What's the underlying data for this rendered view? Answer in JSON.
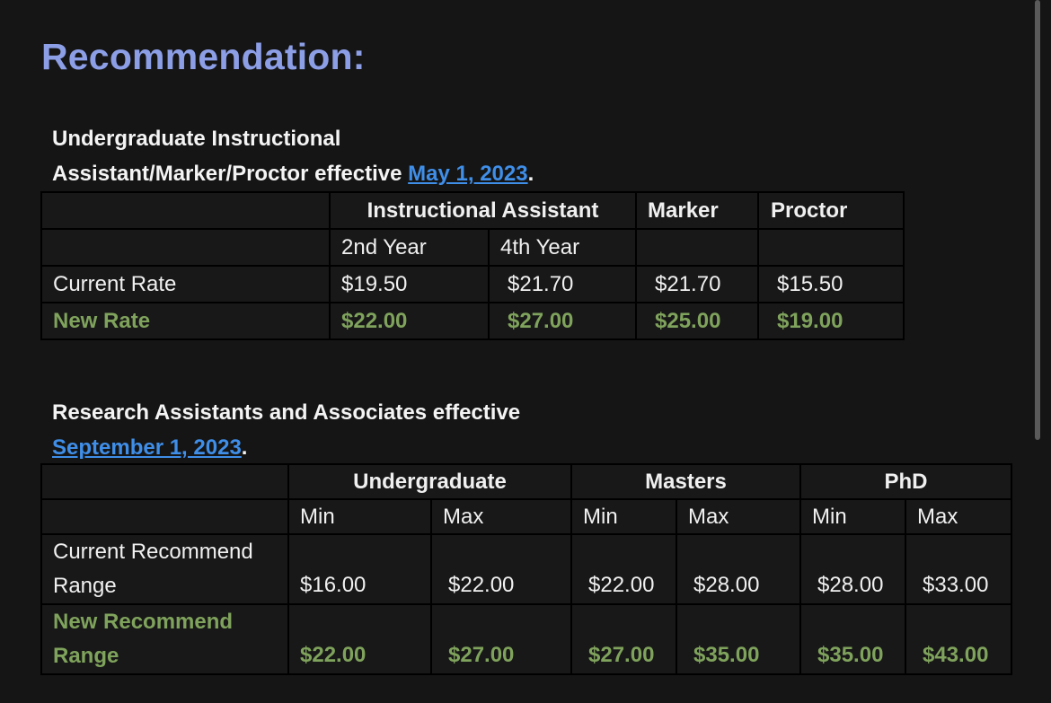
{
  "heading": "Recommendation:",
  "section1": {
    "title_line1": "Undergraduate Instructional",
    "title_line2_prefix": "Assistant/Marker/Proctor effective ",
    "title_link": "May 1, 2023",
    "title_suffix": ".",
    "header": {
      "instructional_assistant": "Instructional Assistant",
      "marker": "Marker",
      "proctor": "Proctor",
      "second_year": "2nd Year",
      "fourth_year": "4th Year"
    },
    "rows": [
      {
        "label": "Current Rate",
        "values": [
          "$19.50",
          "$21.70",
          "$21.70",
          "$15.50"
        ]
      },
      {
        "label": "New Rate",
        "values": [
          "$22.00",
          "$27.00",
          "$25.00",
          "$19.00"
        ]
      }
    ]
  },
  "section2": {
    "title_line1": "Research Assistants and Associates effective",
    "title_link": "September 1, 2023",
    "title_suffix": ".",
    "header": {
      "undergraduate": "Undergraduate",
      "masters": "Masters",
      "phd": "PhD",
      "min": "Min",
      "max": "Max"
    },
    "rows": [
      {
        "label_line1": "Current Recommend",
        "label_line2": "Range",
        "values": [
          "$16.00",
          "$22.00",
          "$22.00",
          "$28.00",
          "$28.00",
          "$33.00"
        ]
      },
      {
        "label_line1": "New Recommend",
        "label_line2": "Range",
        "values": [
          "$22.00",
          "$27.00",
          "$27.00",
          "$35.00",
          "$35.00",
          "$43.00"
        ]
      }
    ]
  },
  "colors": {
    "background": "#151515",
    "heading": "#8c9ee6",
    "link": "#3f8ee8",
    "new_rate_green": "#7fa35c"
  }
}
